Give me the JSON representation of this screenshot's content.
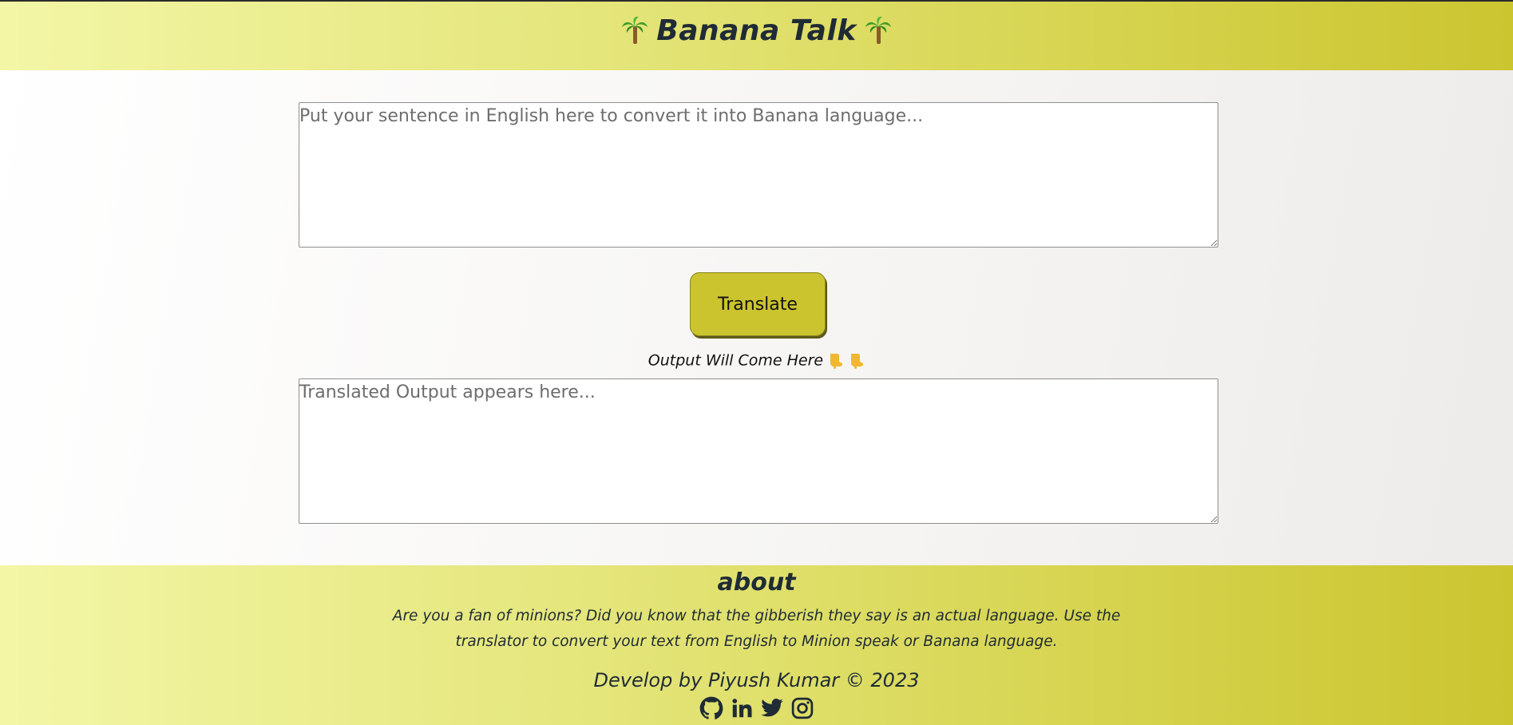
{
  "header": {
    "title": "Banana Talk",
    "left_icon": "palm-tree-icon",
    "right_icon": "palm-tree-icon"
  },
  "input": {
    "placeholder": "Put your sentence in English here to convert it into Banana language...",
    "value": ""
  },
  "translate_button": {
    "label": "Translate"
  },
  "output_hint": {
    "text": "Output Will Come Here",
    "icons": [
      "pointing-down-icon",
      "pointing-down-icon"
    ]
  },
  "output": {
    "placeholder": "Translated Output appears here...",
    "value": ""
  },
  "footer": {
    "about_heading": "about",
    "about_text": "Are you a fan of minions? Did you know that the gibberish they say is an actual language. Use the translator to convert your text from English to Minion speak or Banana language.",
    "credit": "Develop by Piyush Kumar © 2023",
    "social_icons": [
      "github-icon",
      "linkedin-icon",
      "twitter-icon",
      "instagram-icon"
    ]
  },
  "colors": {
    "accent": "#cbc42f",
    "header_gradient_start": "#f3f6a6",
    "header_gradient_end": "#cbc530",
    "text_dark": "#1f2b35"
  }
}
